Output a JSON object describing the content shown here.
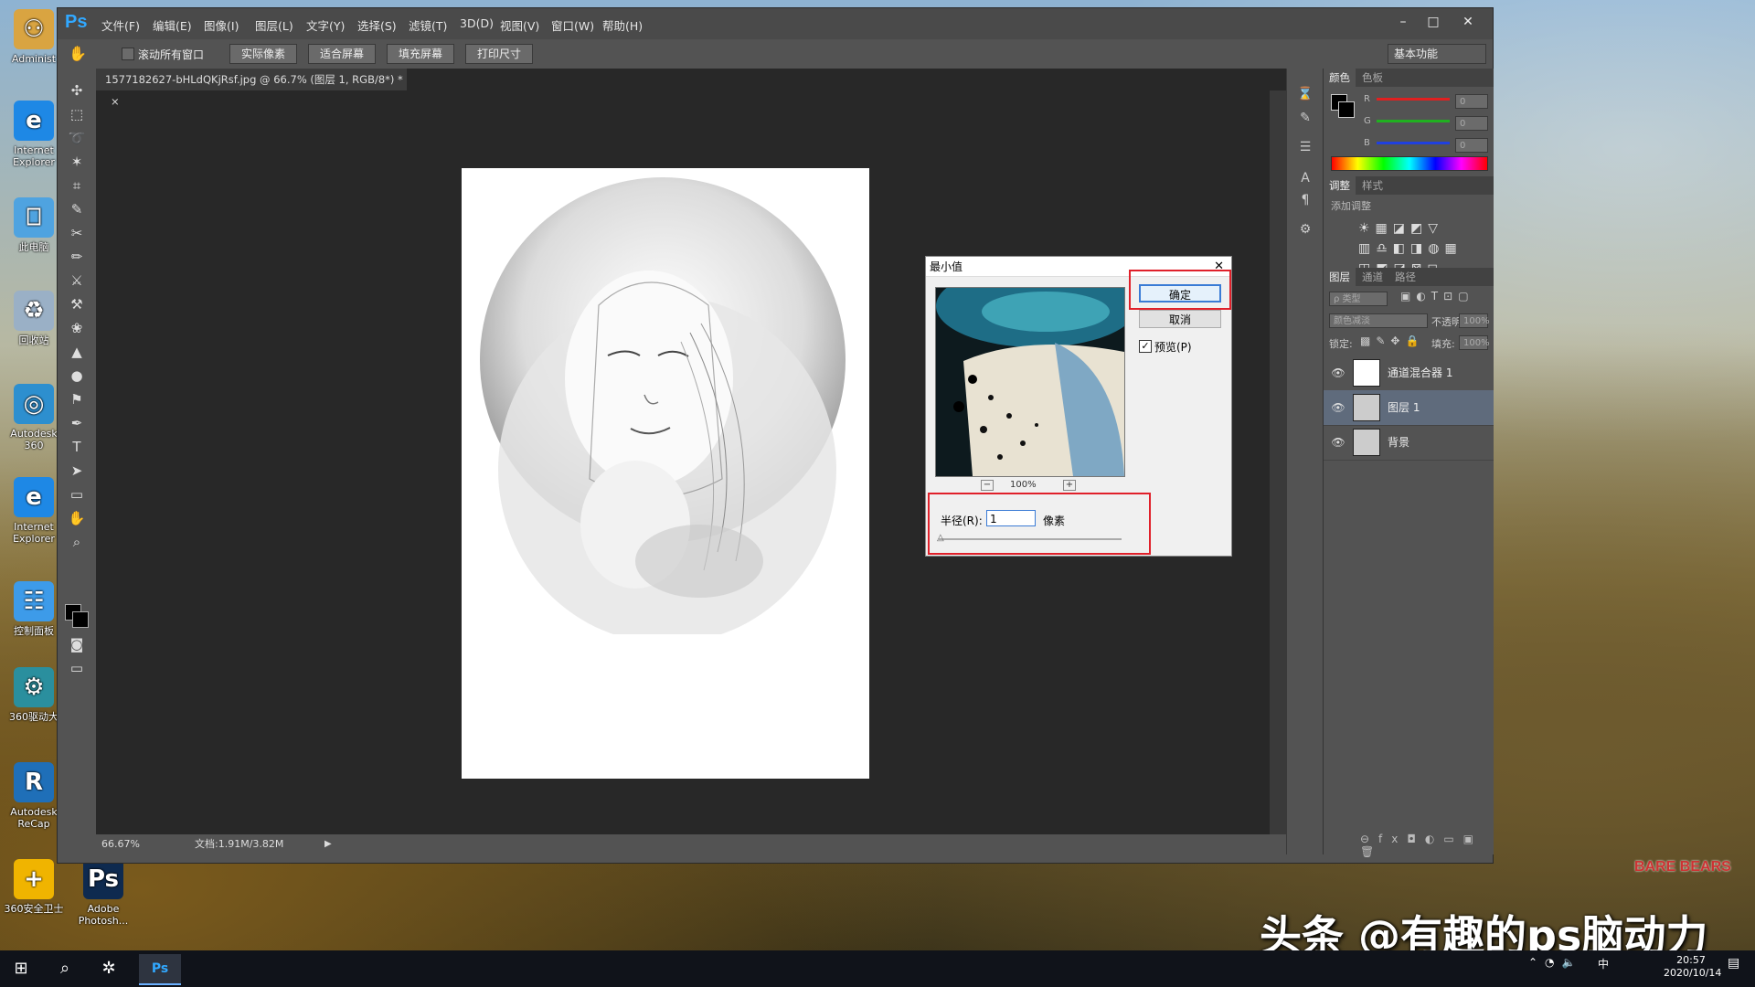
{
  "desktop": {
    "icons": [
      {
        "label": "Administ",
        "glyph": "⚇",
        "color": "#d9a441"
      },
      {
        "label": "Internet Explorer",
        "glyph": "e",
        "color": "#1e88e5"
      },
      {
        "label": "此电脑",
        "glyph": "⎕",
        "color": "#4fa3e0"
      },
      {
        "label": "回收站",
        "glyph": "♻",
        "color": "#9ab0c6"
      },
      {
        "label": "Autodesk 360",
        "glyph": "◎",
        "color": "#2d8fcf"
      },
      {
        "label": "Internet Explorer",
        "glyph": "e",
        "color": "#1e88e5"
      },
      {
        "label": "控制面板",
        "glyph": "☷",
        "color": "#3d9be9"
      },
      {
        "label": "360驱动大",
        "glyph": "⚙",
        "color": "#2a8f9e"
      },
      {
        "label": "Autodesk ReCap",
        "glyph": "R",
        "color": "#1f6fb8"
      },
      {
        "label": "360安全卫士",
        "glyph": "+",
        "color": "#f0b400"
      },
      {
        "label": "Adobe Photosh...",
        "glyph": "Ps",
        "color": "#0e2a4f"
      }
    ]
  },
  "ps": {
    "logo": "Ps",
    "menu": [
      "文件(F)",
      "编辑(E)",
      "图像(I)",
      "图层(L)",
      "文字(Y)",
      "选择(S)",
      "滤镜(T)",
      "3D(D)",
      "视图(V)",
      "窗口(W)",
      "帮助(H)"
    ],
    "window_controls": [
      "–",
      "□",
      "✕"
    ],
    "options": {
      "scroll_all_label": "滚动所有窗口",
      "buttons": [
        "实际像素",
        "适合屏幕",
        "填充屏幕",
        "打印尺寸"
      ],
      "workspace": "基本功能"
    },
    "doc_tab": "1577182627-bHLdQKjRsf.jpg @ 66.7% (图层 1, RGB/8*) *",
    "doc_tab_close": "×",
    "status": {
      "zoom": "66.67%",
      "doc": "文档:1.91M/3.82M"
    },
    "tools": [
      "✣",
      "⬚",
      "➰",
      "✶",
      "⌗",
      "✎",
      "✂",
      "✏",
      "⚔",
      "⚒",
      "❀",
      "▲",
      "●",
      "⚑",
      "✒",
      "T",
      "➤",
      "▭",
      "✋",
      "⌕"
    ],
    "panels": {
      "color_tabs": [
        "颜色",
        "色板"
      ],
      "rgb": [
        {
          "label": "R",
          "value": "0",
          "color": "#e02020"
        },
        {
          "label": "G",
          "value": "0",
          "color": "#20b020"
        },
        {
          "label": "B",
          "value": "0",
          "color": "#2040e0"
        }
      ],
      "adjust_tabs": [
        "调整",
        "样式"
      ],
      "adjust_hint": "添加调整",
      "layer_tabs": [
        "图层",
        "通道",
        "路径"
      ],
      "filter_kind": "ρ 类型",
      "blend_mode": "颜色减淡",
      "opacity_label": "不透明度:",
      "opacity_value": "100%",
      "lock_label": "锁定:",
      "fill_label": "填充:",
      "fill_value": "100%",
      "layers": [
        {
          "name": "通道混合器 1",
          "selected": false
        },
        {
          "name": "图层 1",
          "selected": true
        },
        {
          "name": "背景",
          "selected": false
        }
      ]
    }
  },
  "dialog": {
    "title": "最小值",
    "close": "✕",
    "ok": "确定",
    "cancel": "取消",
    "preview_label": "预览(P)",
    "preview_checked": true,
    "zoom_minus": "−",
    "zoom": "100%",
    "zoom_plus": "+",
    "radius_label": "半径(R):",
    "radius_value": "1",
    "radius_unit": "像素",
    "highlight_color": "#e0202a"
  },
  "taskbar": {
    "time": "20:57",
    "date": "2020/10/14",
    "ime": "中",
    "start_glyph": "⊞",
    "search_glyph": "⌕"
  },
  "watermark": "头条 @有趣的ps脑动力",
  "bears_logo": "BARE BEARS"
}
